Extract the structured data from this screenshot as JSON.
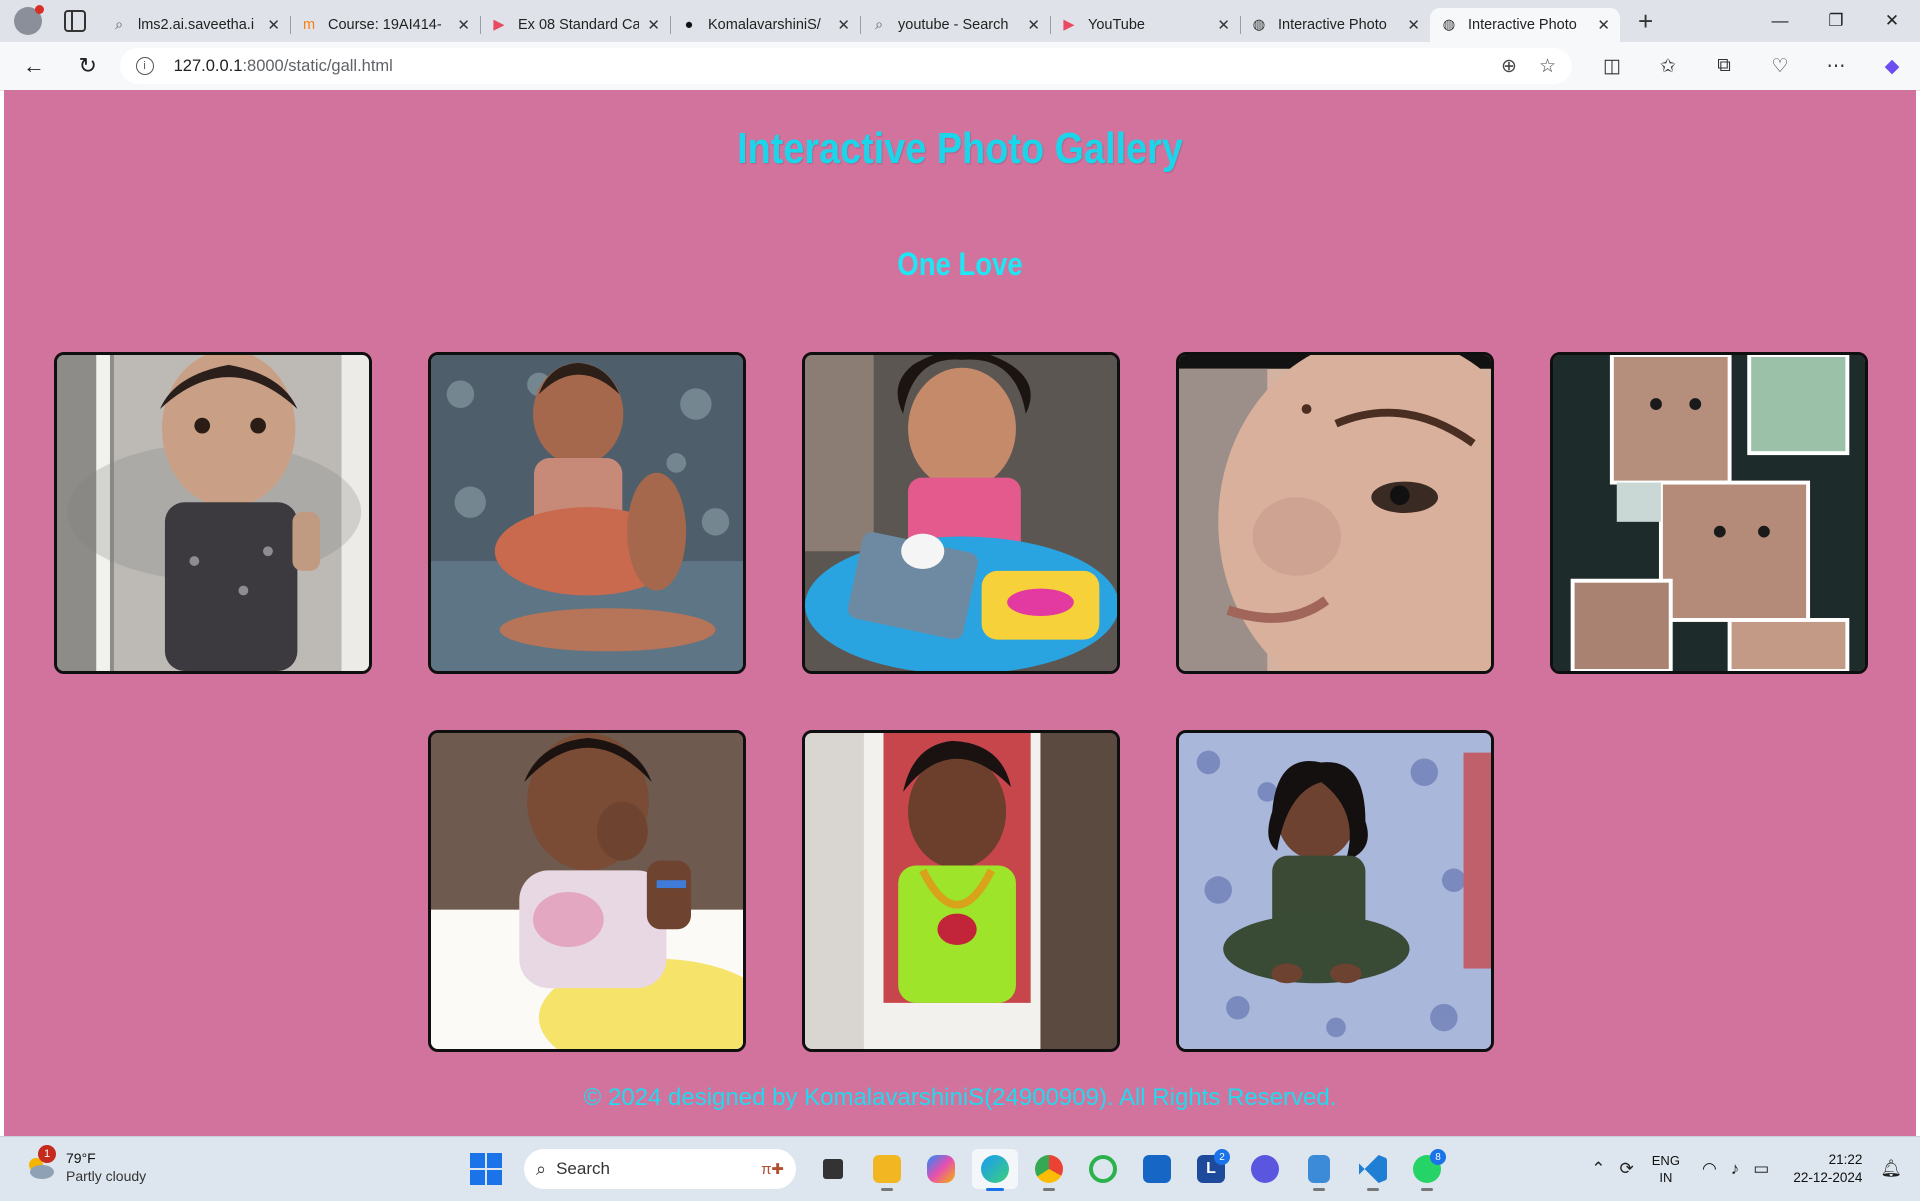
{
  "browser": {
    "tabs": [
      {
        "title": "lms2.ai.saveetha.i",
        "icon": "search-icon",
        "icon_color": "#5f6368",
        "active": false
      },
      {
        "title": "Course: 19AI414-",
        "icon": "moodle-icon",
        "icon_color": "#f98012",
        "active": false
      },
      {
        "title": "Ex 08 Standard Ca",
        "icon": "youtube-icon",
        "icon_color": "#e94a62",
        "active": false
      },
      {
        "title": "KomalavarshiniS/",
        "icon": "github-icon",
        "icon_color": "#111111",
        "active": false
      },
      {
        "title": "youtube - Search",
        "icon": "search-icon",
        "icon_color": "#5f6368",
        "active": false
      },
      {
        "title": "YouTube",
        "icon": "youtube-icon",
        "icon_color": "#e94a62",
        "active": false
      },
      {
        "title": "Interactive Photo",
        "icon": "globe-icon",
        "icon_color": "#333333",
        "active": false
      },
      {
        "title": "Interactive Photo",
        "icon": "globe-icon",
        "icon_color": "#333333",
        "active": true
      }
    ],
    "url_host": "127.0.0.1",
    "url_path": ":8000/static/gall.html"
  },
  "page": {
    "title": "Interactive Photo Gallery",
    "subtitle": "One Love",
    "footer": "© 2024 designed by KomalavarshiniS(24900909). All Rights Reserved.",
    "background": "#d2739d",
    "title_color": "#1bd6ea",
    "photos": [
      {
        "id": "photo-1",
        "desc": "toddler portrait in dark dress against light wall"
      },
      {
        "id": "photo-2",
        "desc": "child sitting on blue floral blanket"
      },
      {
        "id": "photo-3",
        "desc": "girl in pink dress sitting in blue baby walker"
      },
      {
        "id": "photo-4",
        "desc": "close-up of a child's face"
      },
      {
        "id": "photo-5",
        "desc": "collage of child portraits in white frames"
      },
      {
        "id": "photo-6",
        "desc": "child with hand to chin in pastel dress"
      },
      {
        "id": "photo-7",
        "desc": "girl in green dress with gold necklace"
      },
      {
        "id": "photo-8",
        "desc": "girl sitting on blue floral sheet"
      }
    ]
  },
  "taskbar": {
    "weather_temp": "79°F",
    "weather_cond": "Partly cloudy",
    "weather_badge": "1",
    "search_placeholder": "Search",
    "lang_top": "ENG",
    "lang_bottom": "IN",
    "time": "21:22",
    "date": "22-12-2024",
    "badge_l": "2",
    "badge_whatsapp": "8"
  }
}
